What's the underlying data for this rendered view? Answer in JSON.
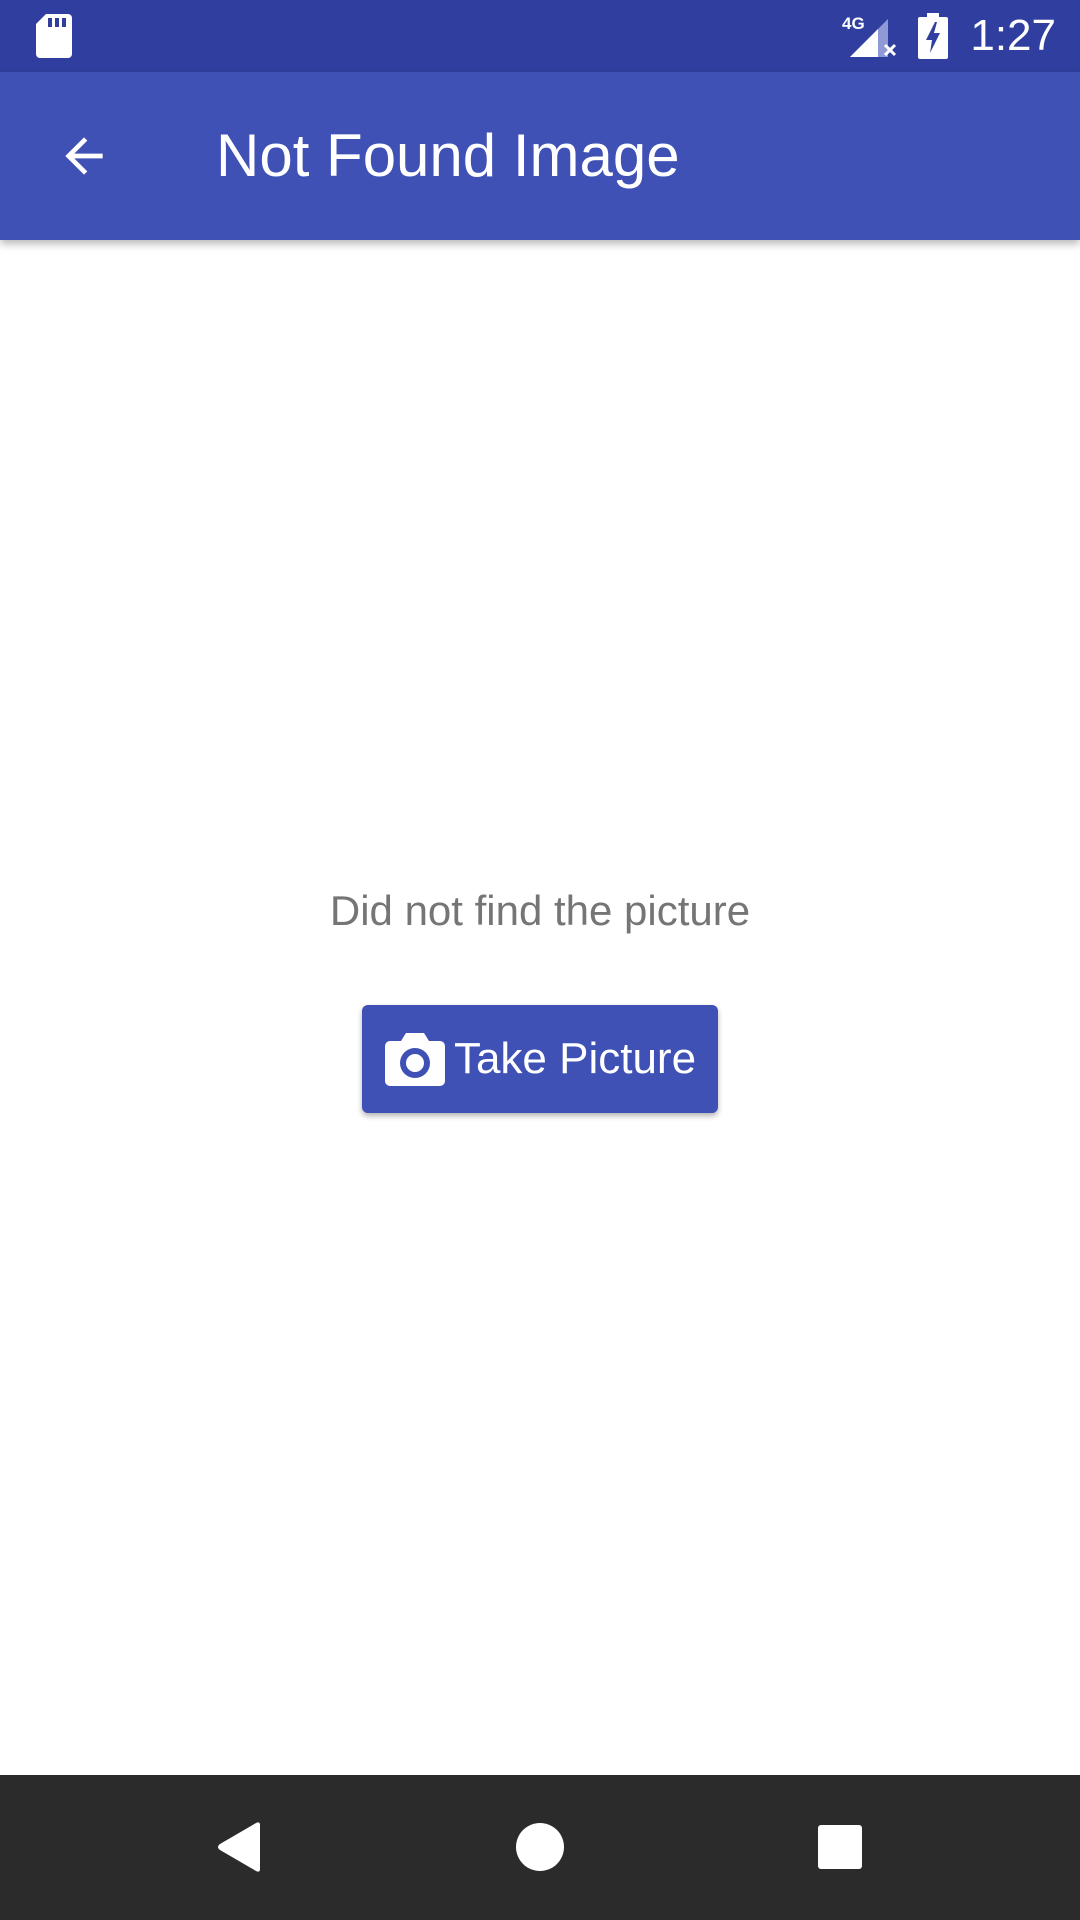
{
  "status_bar": {
    "time": "1:27",
    "network_label": "4G",
    "left_icon": "sd-card-icon",
    "signal_icon": "cell-signal-no-data-icon",
    "battery_icon": "battery-charging-icon"
  },
  "app_bar": {
    "title": "Not Found Image",
    "back_icon": "arrow-back-icon"
  },
  "content": {
    "message": "Did not find the picture",
    "button": {
      "label": "Take Picture",
      "icon": "camera-icon"
    }
  },
  "nav_bar": {
    "back_icon": "nav-back-icon",
    "home_icon": "nav-home-icon",
    "recents_icon": "nav-recents-icon"
  },
  "colors": {
    "status_bar": "#303f9f",
    "primary": "#3f51b5",
    "message_text": "#757575",
    "nav_bar": "#2b2b2b"
  }
}
